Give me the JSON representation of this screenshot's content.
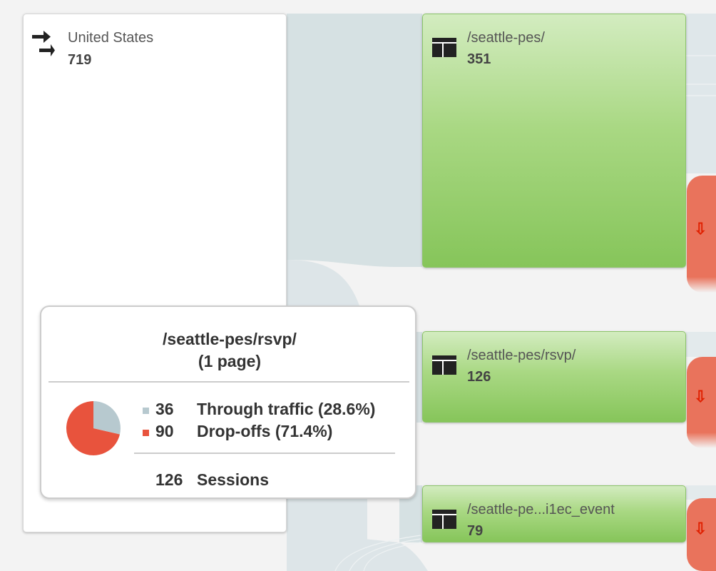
{
  "colors": {
    "background": "#f3f3f3",
    "flow": "#d6e1e3",
    "page_node_top": "#d3ecc0",
    "page_node_bottom": "#86c55a",
    "dropoff": "#e9735c",
    "dropoff_arrow": "#e02000",
    "through_traffic": "#b7c9cf",
    "drop_offs": "#e8533d"
  },
  "source_node": {
    "icon": "arrows-right-icon",
    "label": "United States",
    "count": "719"
  },
  "page_nodes": [
    {
      "icon": "page-layout-icon",
      "label": "/seattle-pes/",
      "count": "351"
    },
    {
      "icon": "page-layout-icon",
      "label": "/seattle-pes/rsvp/",
      "count": "126"
    },
    {
      "icon": "page-layout-icon",
      "label": "/seattle-pe...i1ec_event",
      "count": "79"
    }
  ],
  "dropoff_icon": "down-arrow-icon",
  "dropoff_glyph": "⇩",
  "tooltip": {
    "title": "/seattle-pes/rsvp/",
    "subtitle": "(1 page)",
    "through_traffic": {
      "count": "36",
      "label": "Through traffic (28.6%)",
      "fraction": 0.286
    },
    "drop_offs": {
      "count": "90",
      "label": "Drop-offs (71.4%)",
      "fraction": 0.714
    },
    "sessions": {
      "count": "126",
      "label": "Sessions"
    }
  }
}
